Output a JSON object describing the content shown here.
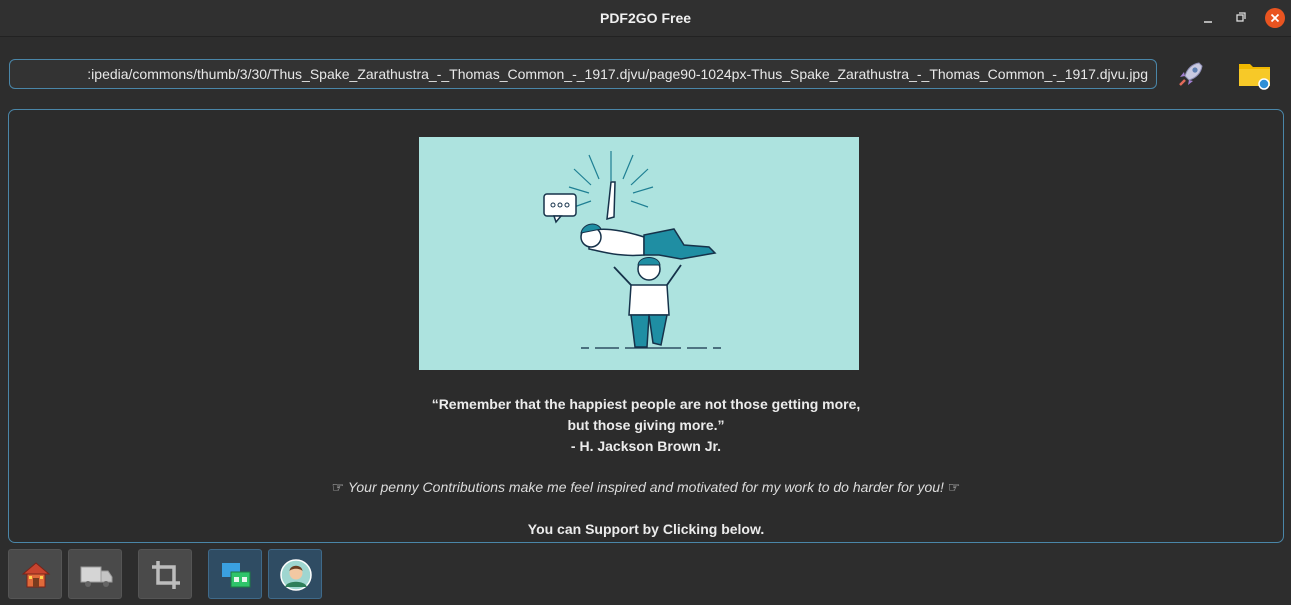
{
  "window": {
    "title": "PDF2GO Free",
    "controls": {
      "minimize": "minimize-icon",
      "maximize": "maximize-icon",
      "close": "close-icon"
    },
    "close_color": "#e95420"
  },
  "toolbar": {
    "url_value": ":ipedia/commons/thumb/3/30/Thus_Spake_Zarathustra_-_Thomas_Common_-_1917.djvu/page90-1024px-Thus_Spake_Zarathustra_-_Thomas_Common_-_1917.djvu.jpg",
    "rocket_icon": "rocket-icon",
    "folder_icon": "folder-search-icon",
    "accent": "#4a86a8"
  },
  "main": {
    "illustration": "people-helping-illustration",
    "illustration_bg": "#ade3df",
    "quote_line1": "“Remember that the happiest people are not those getting more,",
    "quote_line2": "but those giving more.”",
    "quote_author": "- H. Jackson Brown Jr.",
    "contribution_text": "☞ Your penny Contributions make me feel inspired and motivated for my work to do harder for you! ☞",
    "support_text": "You can Support by Clicking below."
  },
  "bottom_bar": {
    "buttons": [
      {
        "icon": "home-icon"
      },
      {
        "icon": "truck-icon"
      },
      {
        "icon": "crop-icon"
      },
      {
        "icon": "windows-icon"
      },
      {
        "icon": "avatar-icon"
      }
    ]
  }
}
